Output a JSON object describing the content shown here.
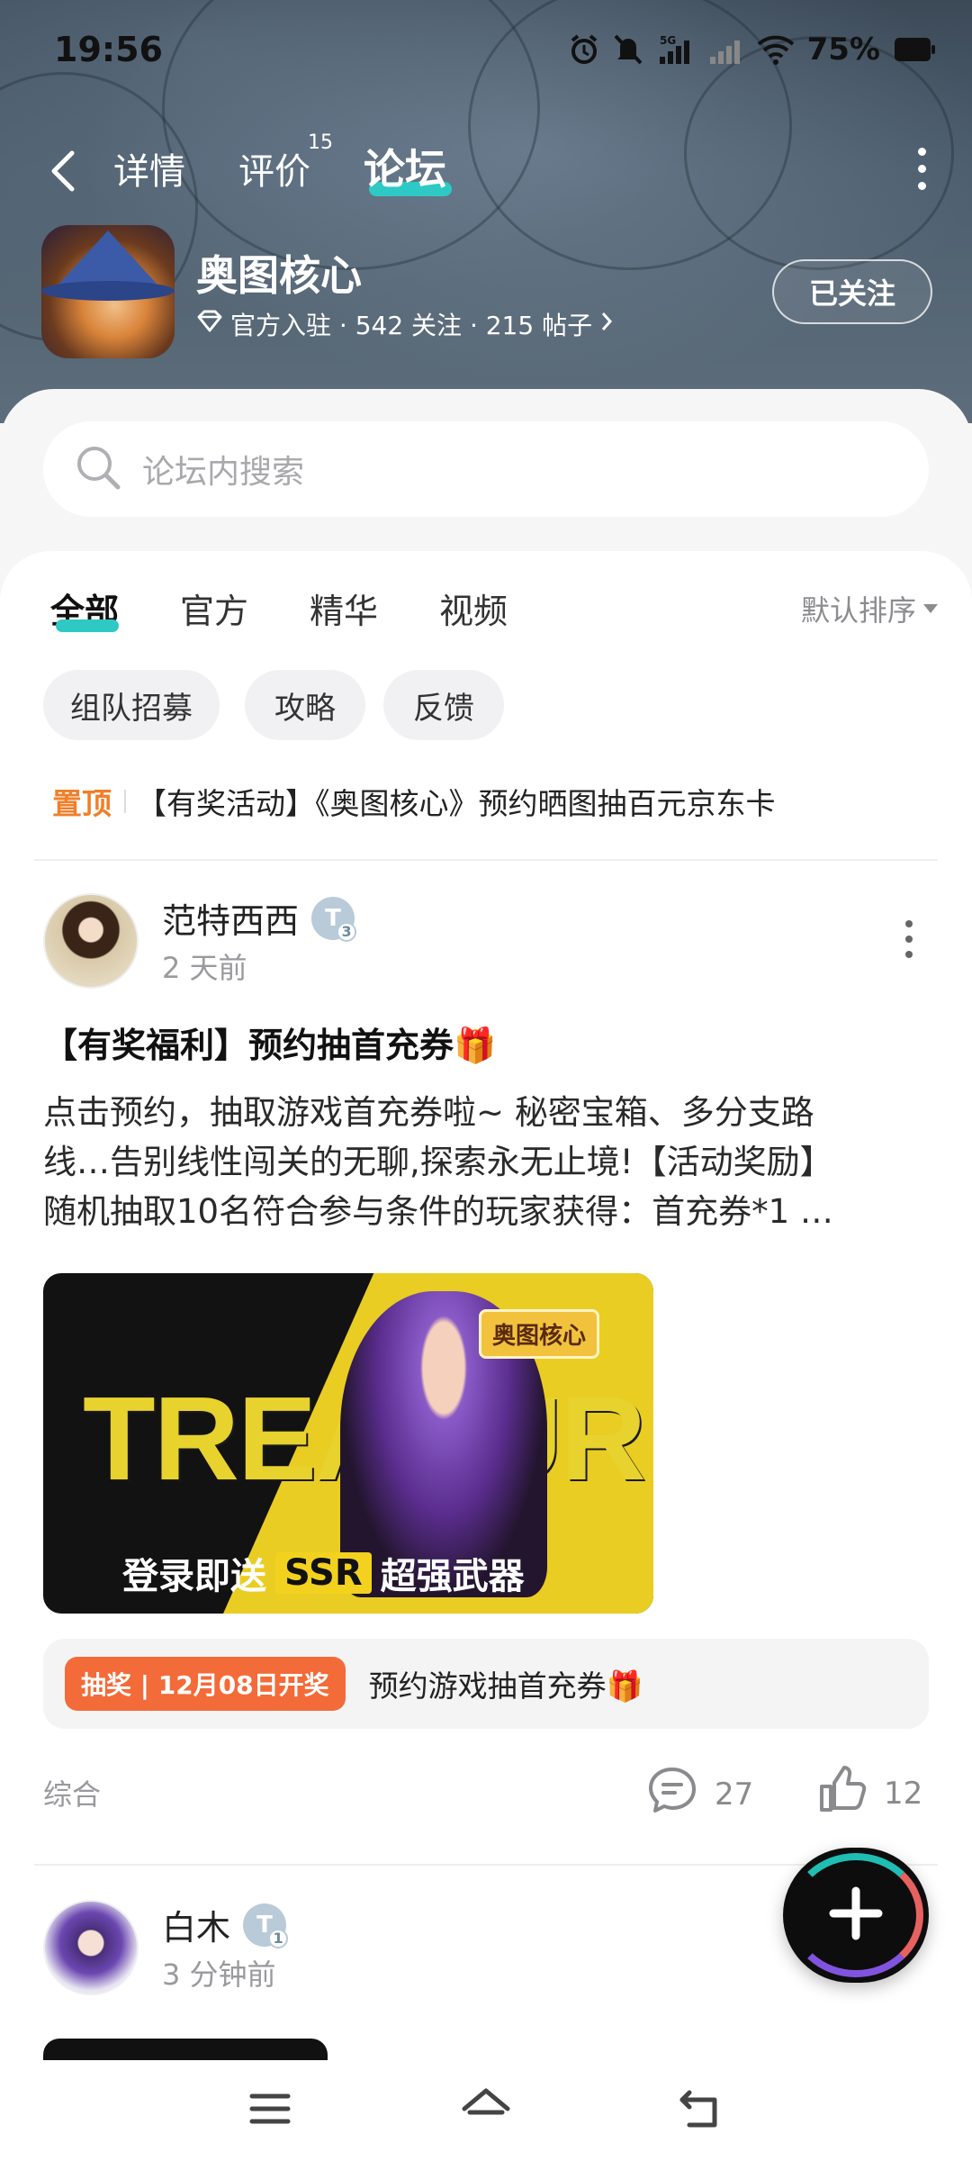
{
  "status_bar": {
    "time": "19:56",
    "battery": "75%",
    "network": "5G"
  },
  "nav": {
    "tabs": [
      {
        "label": "详情"
      },
      {
        "label": "评价",
        "badge": "15"
      },
      {
        "label": "论坛",
        "active": true
      }
    ]
  },
  "app": {
    "name": "奥图核心",
    "meta": "官方入驻 · 542 关注 · 215 帖子",
    "follow_label": "已关注"
  },
  "search": {
    "placeholder": "论坛内搜索"
  },
  "filter_tabs": [
    {
      "label": "全部",
      "active": true
    },
    {
      "label": "官方"
    },
    {
      "label": "精华"
    },
    {
      "label": "视频"
    }
  ],
  "sort_label": "默认排序",
  "chips": [
    "组队招募",
    "攻略",
    "反馈"
  ],
  "pinned": {
    "tag": "置顶",
    "title": "【有奖活动】《奥图核心》预约晒图抽百元京东卡"
  },
  "posts": [
    {
      "author": "范特西西",
      "level": "3",
      "time": "2 天前",
      "title": "【有奖福利】预约抽首充券🎁",
      "body_lines": [
        "点击预约，抽取游戏首充券啦~ 秘密宝箱、多分支路",
        "线…告别线性闯关的无聊,探索永无止境!【活动奖励】",
        "随机抽取10名符合参与条件的玩家获得：首充券*1 …"
      ],
      "image": {
        "big_text": "TREASURE",
        "logo_text": "奥图核心",
        "caption_pre": "登录即送",
        "caption_ssr": "SSR",
        "caption_post": "超强武器"
      },
      "lottery": {
        "badge": "抽奖 | 12月08日开奖",
        "text": "预约游戏抽首充券🎁"
      },
      "category": "综合",
      "comments": "27",
      "likes": "12"
    },
    {
      "author": "白木",
      "level": "1",
      "time": "3 分钟前"
    }
  ],
  "colors": {
    "accent": "#2ec9c4",
    "pinned_tag": "#f07f2a",
    "lottery_badge": "#f36b38"
  }
}
